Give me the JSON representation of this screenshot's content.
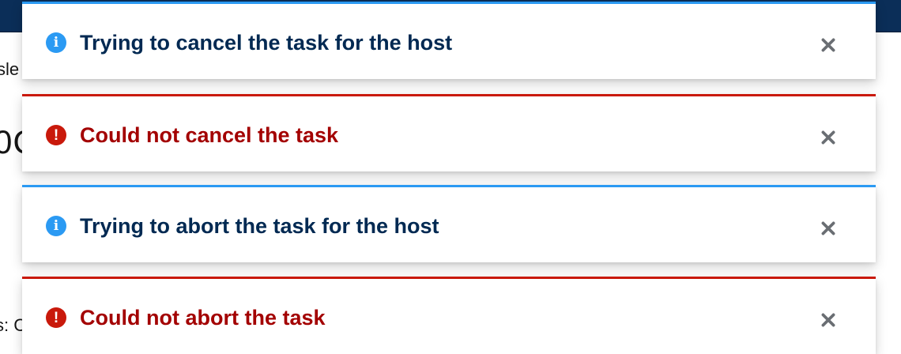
{
  "background": {
    "fragment_1": "sle",
    "fragment_2": "0C",
    "fragment_3": "s: C"
  },
  "alerts": [
    {
      "variant": "info",
      "icon": "info-circle-icon",
      "title": "Trying to cancel the task for the host",
      "close_icon": "close-icon",
      "color": "#2b9af3"
    },
    {
      "variant": "danger",
      "icon": "exclamation-circle-icon",
      "title": "Could not cancel the task",
      "close_icon": "close-icon",
      "color": "#c9190b"
    },
    {
      "variant": "info",
      "icon": "info-circle-icon",
      "title": "Trying to abort the task for the host",
      "close_icon": "close-icon",
      "color": "#2b9af3"
    },
    {
      "variant": "danger",
      "icon": "exclamation-circle-icon",
      "title": "Could not abort the task",
      "close_icon": "close-icon",
      "color": "#c9190b"
    }
  ],
  "glyphs": {
    "info": "i",
    "danger": "!"
  }
}
